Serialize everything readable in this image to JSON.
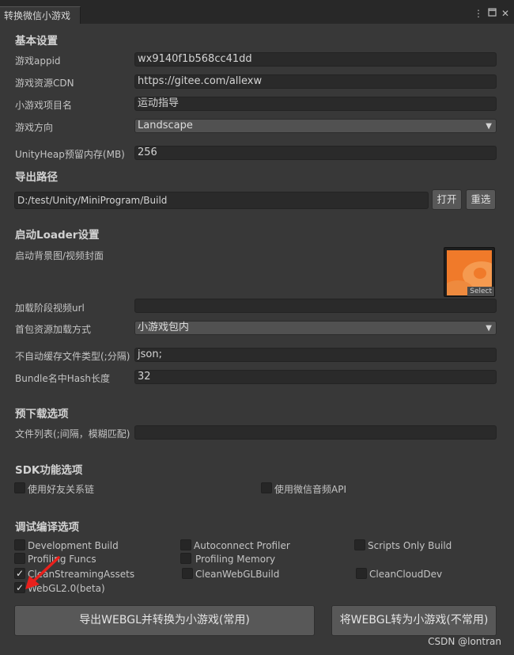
{
  "window": {
    "tab_title": "转换微信小游戏",
    "icons": [
      "more-vertical-icon",
      "maximize-icon",
      "close-icon"
    ]
  },
  "basic": {
    "title": "基本设置",
    "appid_label": "游戏appid",
    "appid_value": "wx9140f1b568cc41dd",
    "cdn_label": "游戏资源CDN",
    "cdn_value": "https://gitee.com/allexw",
    "project_label": "小游戏项目名",
    "project_value": " 运动指导",
    "orientation_label": "游戏方向",
    "orientation_value": "Landscape",
    "heap_label": "UnityHeap预留内存(MB)",
    "heap_value": "256"
  },
  "export": {
    "title": "导出路径",
    "path_value": "D:/test/Unity/MiniProgram/Build",
    "open_label": "打开",
    "reset_label": "重选"
  },
  "loader": {
    "title": "启动Loader设置",
    "bg_label": "启动背景图/视频封面",
    "select_label": "Select",
    "video_label": "加载阶段视频url",
    "video_value": "",
    "first_pkg_label": "首包资源加载方式",
    "first_pkg_value": "小游戏包内",
    "nocache_label": "不自动缓存文件类型(;分隔)",
    "nocache_value": "json;",
    "hash_label": "Bundle名中Hash长度",
    "hash_value": "32"
  },
  "preload": {
    "title": "预下载选项",
    "files_label": "文件列表(;间隔，模糊匹配)",
    "files_value": ""
  },
  "sdk": {
    "title": "SDK功能选项",
    "friend_label": "使用好友关系链",
    "friend_checked": false,
    "audio_label": "使用微信音频API",
    "audio_checked": false
  },
  "debug": {
    "title": "调试编译选项",
    "dev_build": "Development Build",
    "autoconnect": "Autoconnect Profiler",
    "scripts_only": "Scripts Only Build",
    "profiling_funcs": "Profiling Funcs",
    "profiling_memory": "Profiling Memory",
    "clean_streaming": "CleanStreamingAssets",
    "clean_webgl": "CleanWebGLBuild",
    "clean_cloud": "CleanCloudDev",
    "webgl2": "WebGL2.0(beta)",
    "check_mark": "✓"
  },
  "actions": {
    "export_convert": "导出WEBGL并转换为小游戏(常用)",
    "convert_only": "将WEBGL转为小游戏(不常用)"
  },
  "watermark": "CSDN @lontran",
  "colors": {
    "background": "#383838",
    "titlebar": "#282828",
    "field": "#2a2a2a",
    "button": "#585858",
    "annotation_arrow": "#e8201c"
  }
}
